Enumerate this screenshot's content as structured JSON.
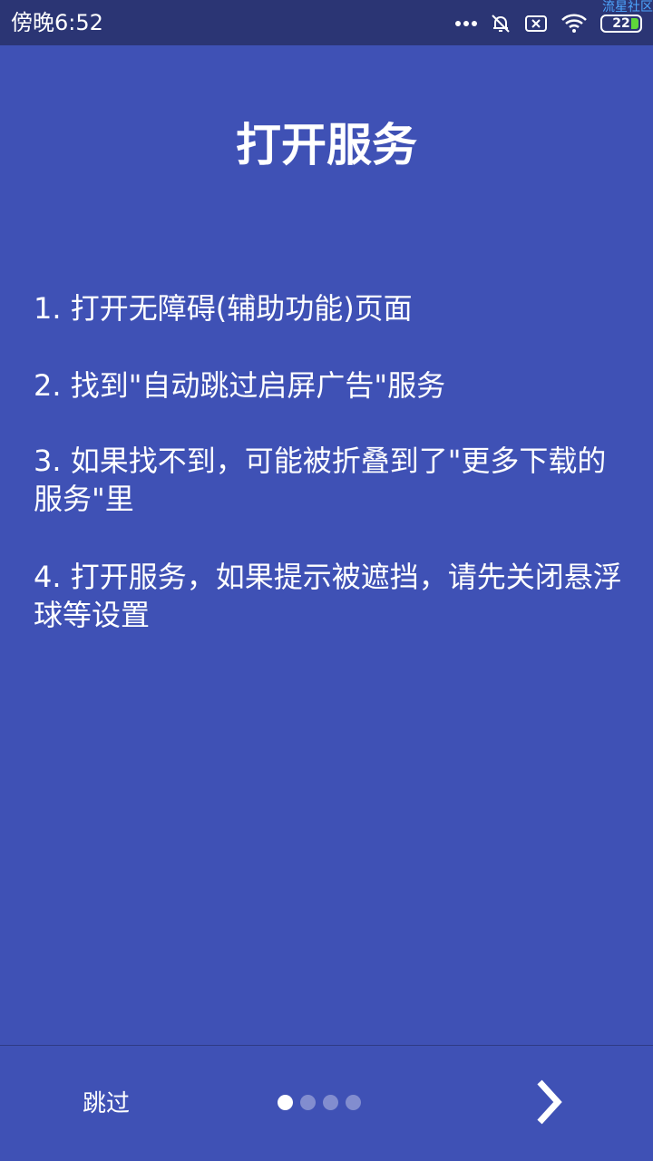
{
  "status_bar": {
    "time": "傍晚6:52",
    "battery_level": "22",
    "icons": [
      "more-dots-icon",
      "bell-off-icon",
      "sim-x-icon",
      "wifi-icon",
      "battery-icon"
    ]
  },
  "watermark": "流星社区",
  "page": {
    "title": "打开服务",
    "steps": [
      "1. 打开无障碍(辅助功能)页面",
      "2. 找到\"自动跳过启屏广告\"服务",
      "3. 如果找不到，可能被折叠到了\"更多下载的服务\"里",
      "4. 打开服务，如果提示被遮挡，请先关闭悬浮球等设置"
    ]
  },
  "footer": {
    "skip_label": "跳过",
    "page_count": 4,
    "current_page": 1,
    "next_icon": "chevron-right-icon"
  },
  "colors": {
    "background": "#3f51b5",
    "status_bar": "#2b3574",
    "battery_fill": "#5fd63a",
    "watermark": "#4ea6ff"
  }
}
